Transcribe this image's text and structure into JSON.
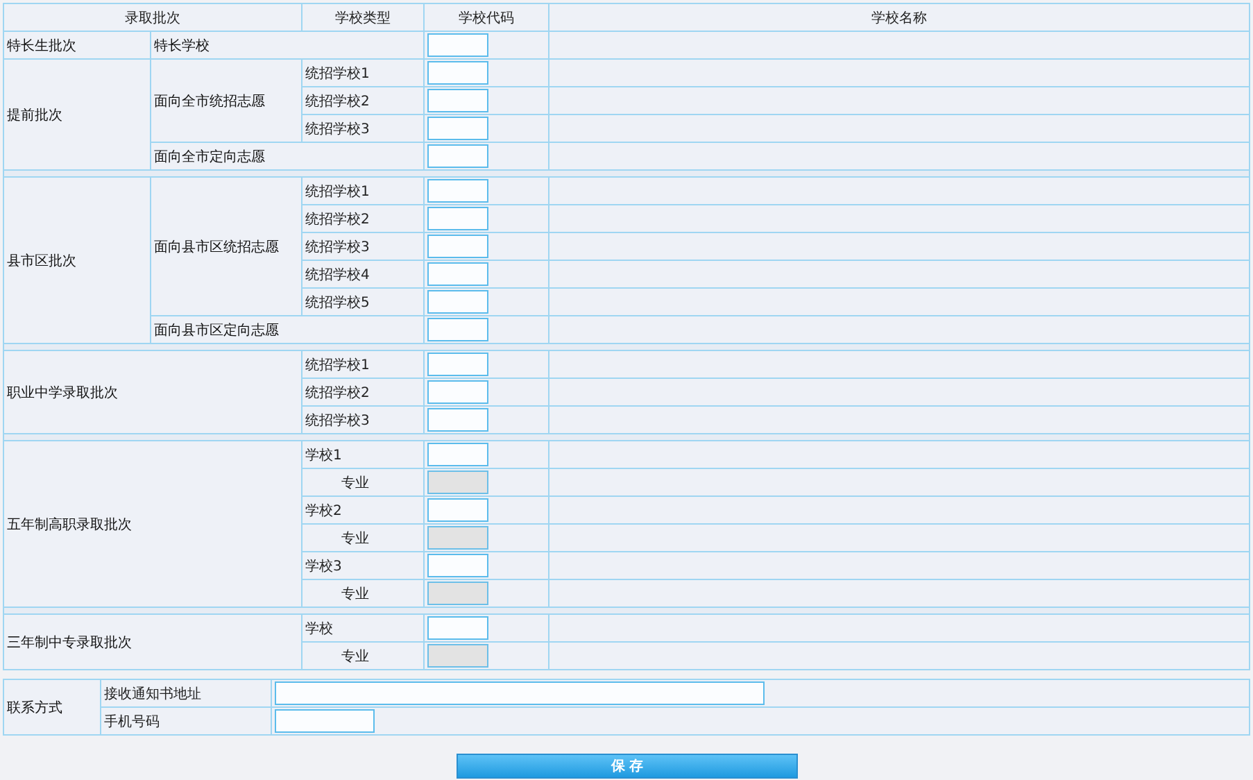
{
  "columns": [
    "录取批次",
    "学校类型",
    "学校代码",
    "学校名称"
  ],
  "blocks": [
    {
      "sections": [
        {
          "batch": "特长生批次",
          "groups": [
            {
              "label": "特长学校",
              "disabled": false
            }
          ]
        },
        {
          "batch": "提前批次",
          "groups": [
            {
              "label": "面向全市统招志愿",
              "items": [
                {
                  "label": "统招学校1",
                  "kind": "school",
                  "disabled": false
                },
                {
                  "label": "统招学校2",
                  "kind": "school",
                  "disabled": false
                },
                {
                  "label": "统招学校3",
                  "kind": "school",
                  "disabled": false
                }
              ]
            },
            {
              "label": "面向全市定向志愿",
              "disabled": false
            }
          ]
        }
      ]
    },
    {
      "sections": [
        {
          "batch": "县市区批次",
          "groups": [
            {
              "label": "面向县市区统招志愿",
              "items": [
                {
                  "label": "统招学校1",
                  "kind": "school",
                  "disabled": false
                },
                {
                  "label": "统招学校2",
                  "kind": "school",
                  "disabled": false
                },
                {
                  "label": "统招学校3",
                  "kind": "school",
                  "disabled": false
                },
                {
                  "label": "统招学校4",
                  "kind": "school",
                  "disabled": false
                },
                {
                  "label": "统招学校5",
                  "kind": "school",
                  "disabled": false
                }
              ]
            },
            {
              "label": "面向县市区定向志愿",
              "disabled": false
            }
          ]
        }
      ]
    },
    {
      "sections": [
        {
          "batch": "职业中学录取批次",
          "items": [
            {
              "label": "统招学校1",
              "kind": "school",
              "disabled": false
            },
            {
              "label": "统招学校2",
              "kind": "school",
              "disabled": false
            },
            {
              "label": "统招学校3",
              "kind": "school",
              "disabled": false
            }
          ]
        }
      ]
    },
    {
      "sections": [
        {
          "batch": "五年制高职录取批次",
          "items": [
            {
              "label": "学校1",
              "kind": "school",
              "disabled": false
            },
            {
              "label": "专业",
              "kind": "major",
              "disabled": true
            },
            {
              "label": "学校2",
              "kind": "school",
              "disabled": false
            },
            {
              "label": "专业",
              "kind": "major",
              "disabled": true
            },
            {
              "label": "学校3",
              "kind": "school",
              "disabled": false
            },
            {
              "label": "专业",
              "kind": "major",
              "disabled": true
            }
          ]
        }
      ]
    },
    {
      "sections": [
        {
          "batch": "三年制中专录取批次",
          "items": [
            {
              "label": "学校",
              "kind": "school",
              "disabled": false
            },
            {
              "label": "专业",
              "kind": "major",
              "disabled": true
            }
          ]
        }
      ]
    }
  ],
  "contact": {
    "label": "联系方式",
    "fields": [
      {
        "label": "接收通知书地址",
        "kind": "wide"
      },
      {
        "label": "手机号码",
        "kind": "short"
      }
    ]
  },
  "save_button": "保 存"
}
